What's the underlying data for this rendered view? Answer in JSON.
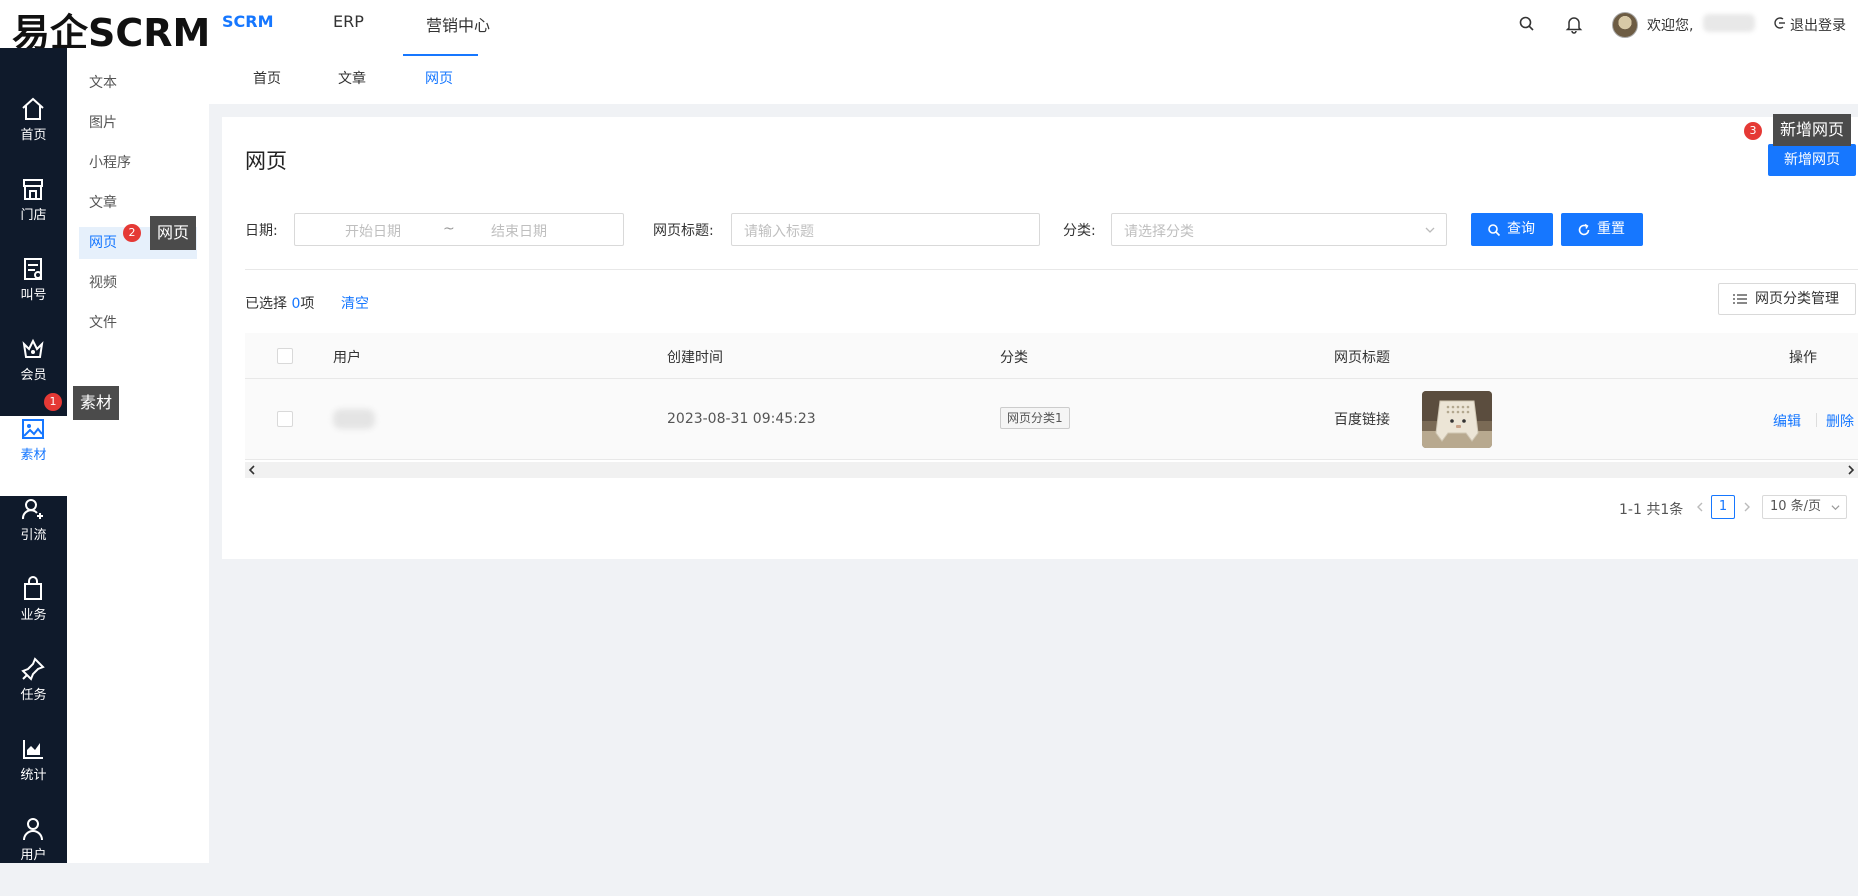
{
  "app": {
    "logo": "易企SCRM"
  },
  "top_nav": [
    {
      "label": "SCRM",
      "active": true
    },
    {
      "label": "ERP",
      "active": false
    },
    {
      "label": "营销中心",
      "active": false
    }
  ],
  "header": {
    "welcome": "欢迎您,",
    "logout": "退出登录",
    "icons": [
      "search-icon",
      "bell-icon",
      "logout-icon"
    ]
  },
  "rail": [
    {
      "label": "首页",
      "icon": "home-icon"
    },
    {
      "label": "门店",
      "icon": "store-icon"
    },
    {
      "label": "叫号",
      "icon": "queue-icon"
    },
    {
      "label": "会员",
      "icon": "crown-icon"
    },
    {
      "label": "素材",
      "icon": "image-icon",
      "active": true
    },
    {
      "label": "引流",
      "icon": "user-add-icon"
    },
    {
      "label": "业务",
      "icon": "bag-icon"
    },
    {
      "label": "任务",
      "icon": "pin-icon"
    },
    {
      "label": "统计",
      "icon": "chart-icon"
    },
    {
      "label": "用户",
      "icon": "user-icon"
    }
  ],
  "sub_nav": [
    {
      "label": "文本"
    },
    {
      "label": "图片"
    },
    {
      "label": "小程序"
    },
    {
      "label": "文章"
    },
    {
      "label": "网页",
      "active": true
    },
    {
      "label": "视频"
    },
    {
      "label": "文件"
    }
  ],
  "tooltips": [
    {
      "step": "1",
      "text": "素材"
    },
    {
      "step": "2",
      "text": "网页"
    },
    {
      "step": "3",
      "text": "新增网页"
    }
  ],
  "tabs": [
    {
      "label": "首页"
    },
    {
      "label": "文章"
    },
    {
      "label": "网页",
      "active": true
    }
  ],
  "page": {
    "title": "网页",
    "add_button": "新增网页",
    "filters": {
      "date_label": "日期:",
      "start_placeholder": "开始日期",
      "range_sep": "~",
      "end_placeholder": "结束日期",
      "title_label": "网页标题:",
      "title_placeholder": "请输入标题",
      "category_label": "分类:",
      "category_placeholder": "请选择分类",
      "query_button": "查询",
      "reset_button": "重置"
    },
    "selection": {
      "prefix": "已选择",
      "count": "0",
      "suffix": "项",
      "clear": "清空"
    },
    "category_manage_button": "网页分类管理",
    "table": {
      "columns": [
        "用户",
        "创建时间",
        "分类",
        "网页标题",
        "操作"
      ],
      "rows": [
        {
          "user": "",
          "created": "2023-08-31 09:45:23",
          "category": "网页分类1",
          "title": "百度链接",
          "actions": [
            "编辑",
            "删除"
          ]
        }
      ]
    },
    "pagination": {
      "summary": "1-1 共1条",
      "current": "1",
      "page_size": "10 条/页"
    }
  },
  "colors": {
    "accent": "#1677ff",
    "rail_bg": "#0f1a2b",
    "marker": "#e53935",
    "tooltip_bg": "#4b4b4b"
  }
}
